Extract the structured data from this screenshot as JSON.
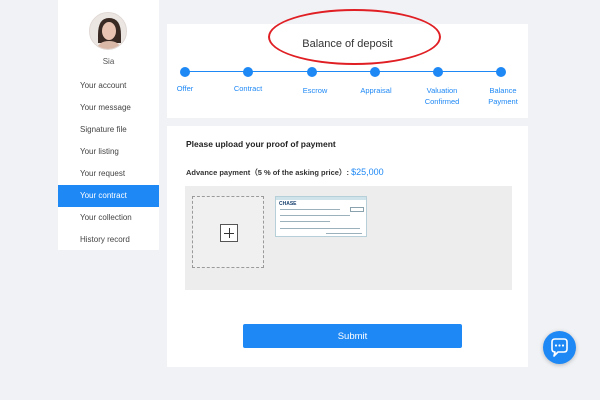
{
  "user": {
    "name": "Sia"
  },
  "sidebar": {
    "items": [
      {
        "label": "Your account"
      },
      {
        "label": "Your message"
      },
      {
        "label": "Signature file"
      },
      {
        "label": "Your listing"
      },
      {
        "label": "Your request"
      },
      {
        "label": "Your contract",
        "active": true
      },
      {
        "label": "Your collection"
      },
      {
        "label": "History record"
      }
    ]
  },
  "progress": {
    "title": "Balance of deposit",
    "steps": [
      {
        "line1": "Offer",
        "line2": ""
      },
      {
        "line1": "Contract",
        "line2": ""
      },
      {
        "line1": "Escrow",
        "line2": ""
      },
      {
        "line1": "Appraisal",
        "line2": ""
      },
      {
        "line1": "Valuation",
        "line2": "Confirmed"
      },
      {
        "line1": "Balance",
        "line2": "Payment"
      }
    ]
  },
  "upload": {
    "title": "Please upload your proof of payment",
    "advance_label": "Advance payment（5 % of the asking price）:",
    "advance_amount": "$25,000",
    "thumbnail_bank_logo": "CHASE"
  },
  "actions": {
    "submit_label": "Submit"
  },
  "colors": {
    "accent": "#1e88f5",
    "highlight_ellipse": "#e01f24",
    "background": "#f1f2f5"
  },
  "icons": {
    "upload_add": "plus-icon",
    "chat": "chat-bubble-icon"
  }
}
